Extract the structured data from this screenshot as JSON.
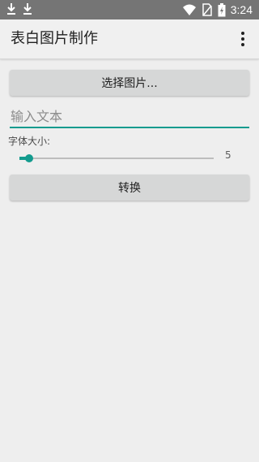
{
  "status_bar": {
    "time": "3:24",
    "left_icons": [
      "download-icon",
      "download-icon"
    ],
    "right_icons": [
      "wifi-icon",
      "no-sim-icon",
      "battery-charging-icon"
    ]
  },
  "app_bar": {
    "title": "表白图片制作",
    "menu_icon": "overflow-menu-icon"
  },
  "select_image_button": "选择图片...",
  "text_input": {
    "placeholder": "输入文本",
    "value": ""
  },
  "font_size": {
    "label": "字体大小:",
    "value": "5",
    "slider_fraction": 0.05
  },
  "convert_button": "转换",
  "colors": {
    "accent": "#139b8e",
    "status_bar": "#757575",
    "background": "#eeeeee",
    "button": "#d6d7d7"
  }
}
